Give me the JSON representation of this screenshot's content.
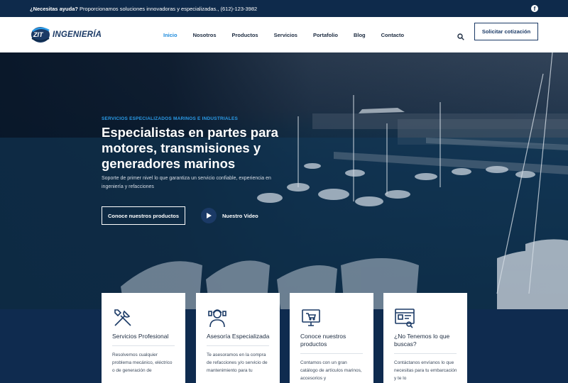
{
  "topbar": {
    "help_label": "¿Necesitas ayuda?",
    "help_text": "Proporcionamos soluciones innovadoras y especializadas., (612)-123-3982",
    "social_icon": "facebook-icon"
  },
  "header": {
    "logo_text": "INGENIERÍA",
    "logo_mark": "ZIT",
    "nav": [
      "Inicio",
      "Nosotros",
      "Productos",
      "Servicios",
      "Portafolio",
      "Blog",
      "Contacto"
    ],
    "active_index": 0,
    "quote_button": "Solicitar cotización",
    "accent_color": "#1f8bdc",
    "brand_color": "#1b3a66"
  },
  "hero": {
    "eyebrow": "SERVICIOS ESPECIALIZADOS MARINOS E INDUSTRIALES",
    "headline": "Especialistas en partes para motores, transmisiones y generadores marinos",
    "subtext": "Soporte de primer nivel lo que garantiza un servicio confiable, experiencia en ingeniería y refacciones",
    "primary_button": "Conoce nuestros productos",
    "video_button": "Nuestro Video"
  },
  "cards": [
    {
      "icon": "tools-icon",
      "title": "Servicios Profesional",
      "text": "Resolvemos cualquier problema mecánico, eléctrico o de generación de"
    },
    {
      "icon": "advisor-icon",
      "title": "Asesoría Especializada",
      "text": "Te asesoramos en la compra de refacciones y/o servicio de mantenimiento para tu"
    },
    {
      "icon": "catalog-monitor-icon",
      "title": "Conoce nuestros productos",
      "text": "Contamos con un gran catálogo de artículos marinos, accesorios y"
    },
    {
      "icon": "search-parts-icon",
      "title": "¿No Tenemos lo que buscas?",
      "text": "Contáctanos envíanos lo que necesitas para tu embarcación y te lo"
    }
  ]
}
